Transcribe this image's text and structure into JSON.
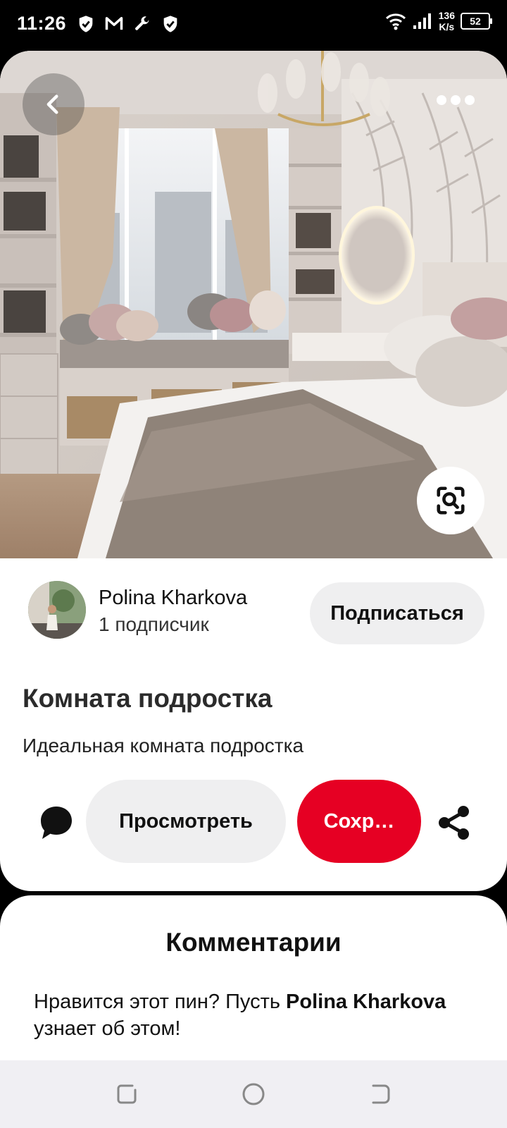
{
  "status_bar": {
    "time": "11:26",
    "speed_value": "136",
    "speed_unit": "K/s",
    "battery": "52"
  },
  "hero": {
    "back_icon": "chevron-left-icon",
    "more_icon": "more-horizontal-icon",
    "lens_icon": "visual-search-icon"
  },
  "author": {
    "name": "Polina Kharkova",
    "followers": "1 подписчик",
    "follow_label": "Подписаться"
  },
  "pin": {
    "title": "Комната подростка",
    "description": "Идеальная комната подростка"
  },
  "actions": {
    "view_label": "Просмотреть",
    "save_label": "Сохр…",
    "comment_icon": "comment-bubble-icon",
    "share_icon": "share-icon"
  },
  "comments": {
    "title": "Комментарии",
    "prompt_before": "Нравится этот пин? Пусть ",
    "prompt_name": "Polina Kharkova",
    "prompt_after": " узнает об этом!"
  },
  "colors": {
    "save_red": "#e60023",
    "button_gray": "#efeff0",
    "navbar_bg": "#f0eff3"
  }
}
